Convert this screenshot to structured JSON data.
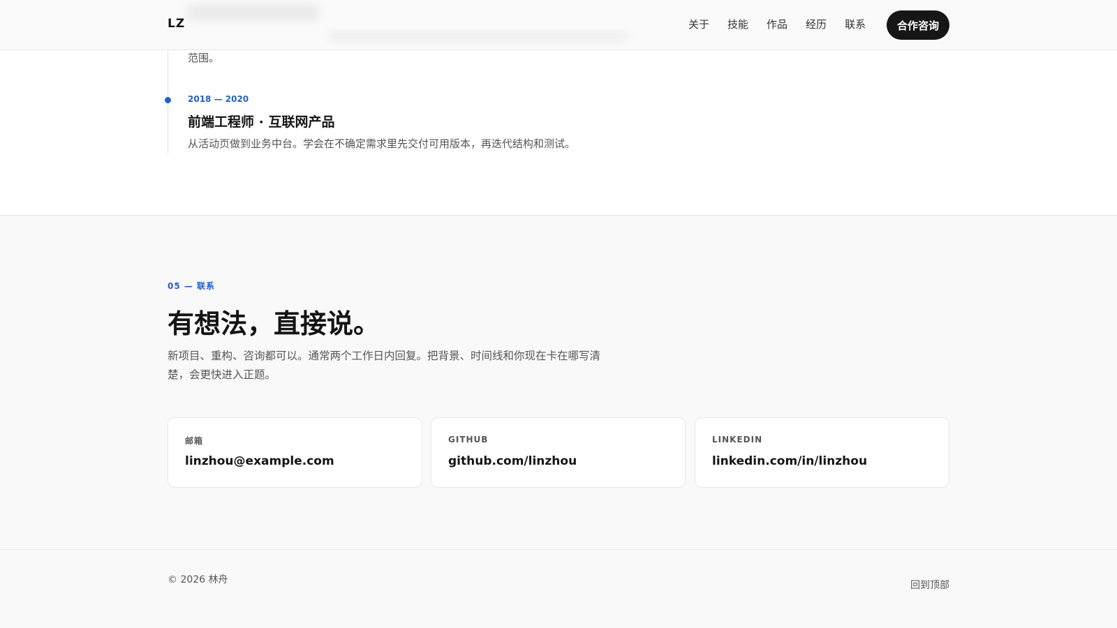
{
  "header": {
    "logo": "LZ",
    "nav": [
      "关于",
      "技能",
      "作品",
      "经历",
      "联系"
    ],
    "cta_label": "合作咨询"
  },
  "timeline": {
    "prev_desc_tail": "范围。",
    "item": {
      "date": "2018 — 2020",
      "title": "前端工程师 · 互联网产品",
      "desc": "从活动页做到业务中台。学会在不确定需求里先交付可用版本，再迭代结构和测试。"
    }
  },
  "contact": {
    "kicker": "05 — 联系",
    "headline": "有想法，直接说。",
    "lead": "新项目、重构、咨询都可以。通常两个工作日内回复。把背景、时间线和你现在卡在哪写清楚，会更快进入正题。",
    "cards": [
      {
        "label": "邮箱",
        "value": "linzhou@example.com"
      },
      {
        "label": "GITHUB",
        "value": "github.com/linzhou"
      },
      {
        "label": "LINKEDIN",
        "value": "linkedin.com/in/linzhou"
      }
    ]
  },
  "footer": {
    "copyright": "© 2026 林舟",
    "back_to_top": "回到顶部"
  },
  "colors": {
    "accent": "#1f5fd6",
    "cta_bg": "#161616",
    "section_bg": "#f9f9f9"
  }
}
